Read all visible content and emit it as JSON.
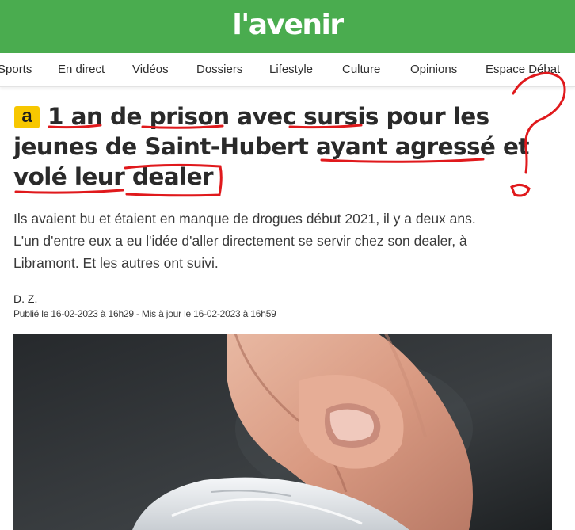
{
  "header": {
    "logo": "l'avenir",
    "bar_color": "#4aac4f"
  },
  "nav": {
    "items": [
      "Sports",
      "En direct",
      "Vidéos",
      "Dossiers",
      "Lifestyle",
      "Culture",
      "Opinions",
      "Espace Débat"
    ]
  },
  "article": {
    "badge": "a",
    "headline_lines": [
      "1 an de prison avec sursis pour les",
      "jeunes de Saint-Hubert ayant agressé et",
      "volé leur dealer"
    ],
    "lead_lines": [
      "Ils avaient bu et étaient en manque de drogues début 2021, il y a deux ans.",
      "L'un d'entre eux a eu l'idée d'aller directement se servir chez son dealer, à",
      "Libramont. Et les autres ont suivi."
    ],
    "author": "D. Z.",
    "published": "Publié le 16-02-2023 à 16h29 - Mis à jour le 16-02-2023 à 16h59",
    "photo_icon": "photo-hand-with-plastic-bag"
  },
  "annotations": {
    "ink_color": "#e0191c",
    "marks": [
      "underline",
      "underline",
      "underline",
      "underline",
      "underline",
      "underline",
      "box",
      "question-mark"
    ]
  }
}
